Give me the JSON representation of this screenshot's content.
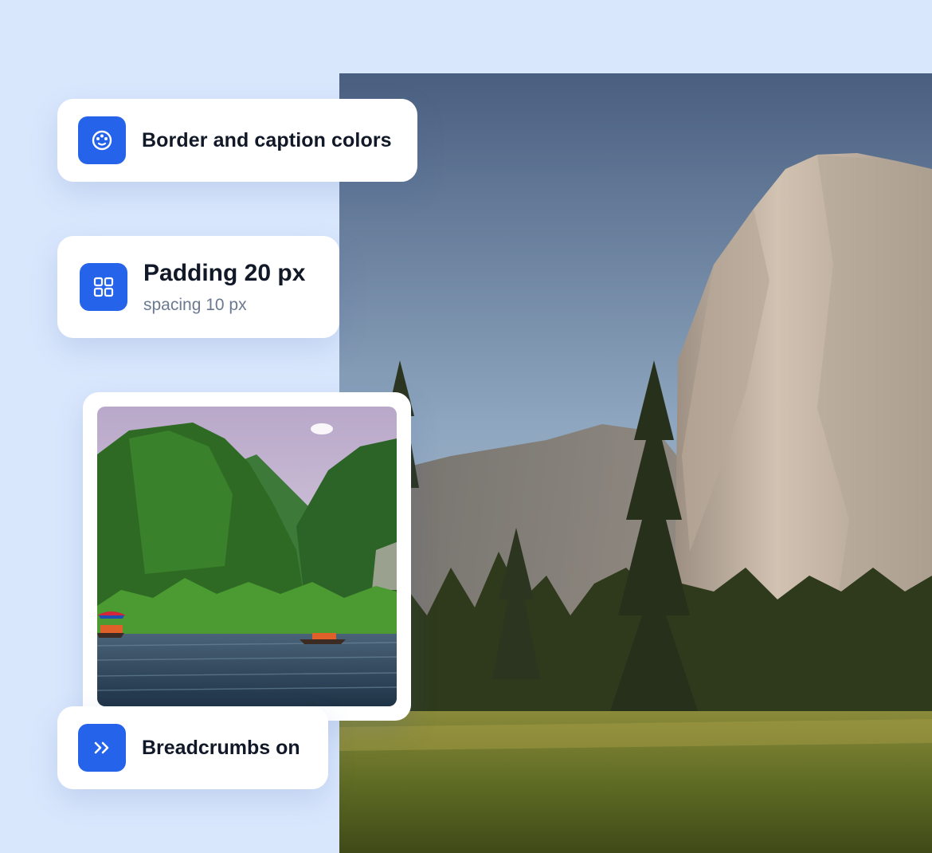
{
  "cards": {
    "colors": {
      "label": "Border and caption colors",
      "icon": "palette-icon"
    },
    "padding": {
      "title": "Padding 20 px",
      "subtitle": "spacing 10 px",
      "icon": "grid-icon"
    },
    "breadcrumbs": {
      "label": "Breadcrumbs on",
      "icon": "double-chevron-right-icon"
    }
  },
  "colors": {
    "background": "#d9e7fd",
    "accent": "#2563eb",
    "card": "#ffffff",
    "text": "#111827",
    "muted": "#6b7a90"
  }
}
